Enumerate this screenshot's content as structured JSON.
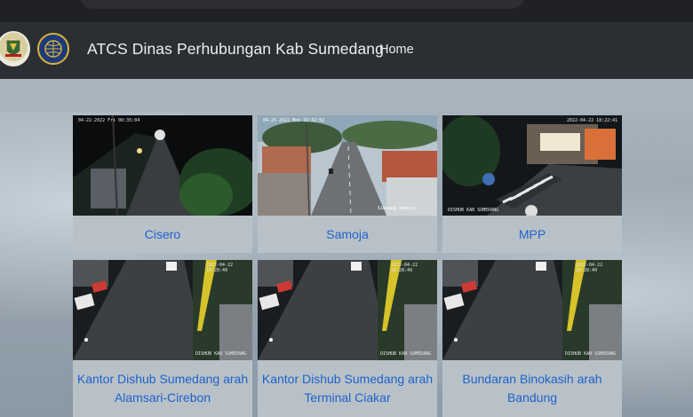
{
  "navbar": {
    "brand": "ATCS Dinas Perhubungan Kab Sumedang",
    "home_link": "Home",
    "logo_left_icon": "sumedang-regency-emblem-icon",
    "logo_right_icon": "dishub-emblem-icon"
  },
  "cameras": [
    {
      "name": "Cisero",
      "timestamp": "04-22-2022 Fri 00:35:04",
      "scene": "night-road"
    },
    {
      "name": "Samoja",
      "timestamp": "04-25-2022 Mon 16:32:02",
      "caption": "Simpang Samoja",
      "scene": "day-road"
    },
    {
      "name": "MPP",
      "timestamp": "2022-04-22 18:22:41",
      "caption": "DISHUB KAB SUMEDANG",
      "scene": "night-crossing"
    },
    {
      "name": "Kantor Dishub Sumedang arah Alamsari-Cirebon",
      "timestamp": "2022-04-22 18:28:40",
      "caption": "DISHUB KAB SUMEDANG",
      "scene": "rainy-night-road"
    },
    {
      "name": "Kantor Dishub Sumedang arah Terminal Ciakar",
      "timestamp": "2022-04-22 18:28:40",
      "caption": "DISHUB KAB SUMEDANG",
      "scene": "rainy-night-road"
    },
    {
      "name": "Bundaran Binokasih arah Bandung",
      "timestamp": "2022-04-22 18:28:40",
      "caption": "DISHUB KAB SUMEDANG",
      "scene": "rainy-night-road"
    }
  ],
  "colors": {
    "link": "#1d62c9",
    "navbar": "#2b2f33"
  }
}
